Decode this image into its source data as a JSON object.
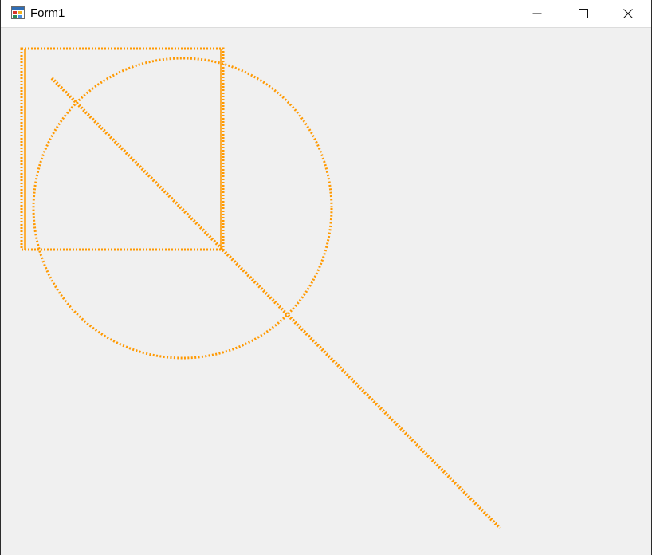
{
  "window": {
    "title": "Form1",
    "app_icon": "winforms-app-icon",
    "controls": {
      "minimize_icon": "minimize-icon",
      "maximize_icon": "maximize-icon",
      "close_icon": "close-icon"
    }
  },
  "colors": {
    "client_background": "#f0f0f0",
    "shape_stroke": "#ff9900",
    "titlebar_background": "#ffffff",
    "outside_background": "#0f6b3f"
  },
  "canvas": {
    "shapes": [
      "rectangle",
      "ellipse",
      "line"
    ],
    "stroke_style": "dotted"
  }
}
